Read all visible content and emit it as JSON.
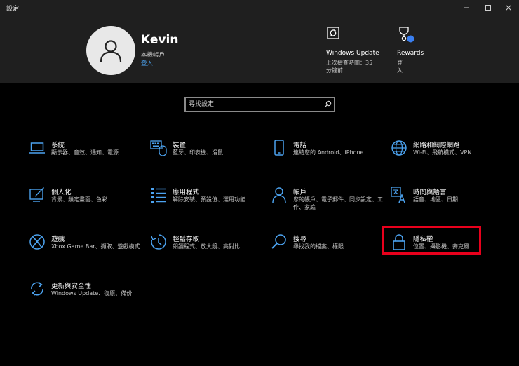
{
  "window": {
    "title": "設定"
  },
  "user": {
    "name": "Kevin",
    "account_type": "本機帳戶",
    "login_link": "登入"
  },
  "header_items": [
    {
      "label": "Windows Update",
      "sub": "上次檢查時間：35 分鐘前"
    },
    {
      "label": "Rewards",
      "sub": "登入"
    }
  ],
  "search": {
    "placeholder": "尋找設定"
  },
  "categories": [
    {
      "name": "系統",
      "desc": "顯示器、音效、通知、電源"
    },
    {
      "name": "裝置",
      "desc": "藍牙、印表機、滑鼠"
    },
    {
      "name": "電話",
      "desc": "連結您的 Android、iPhone"
    },
    {
      "name": "網路和網際網路",
      "desc": "Wi-Fi、飛航模式、VPN"
    },
    {
      "name": "個人化",
      "desc": "背景、鎖定畫面、色彩"
    },
    {
      "name": "應用程式",
      "desc": "解除安裝、預設值、選用功能"
    },
    {
      "name": "帳戶",
      "desc": "您的帳戶、電子郵件、同步設定、工作、家庭"
    },
    {
      "name": "時間與語言",
      "desc": "語音、地區、日期"
    },
    {
      "name": "遊戲",
      "desc": "Xbox Game Bar、擷取、遊戲模式"
    },
    {
      "name": "輕鬆存取",
      "desc": "朗讀程式、放大鏡、高對比"
    },
    {
      "name": "搜尋",
      "desc": "尋找我的檔案、權限"
    },
    {
      "name": "隱私權",
      "desc": "位置、攝影機、麥克風"
    },
    {
      "name": "更新與安全性",
      "desc": "Windows Update、復原、備份"
    }
  ],
  "colors": {
    "accent": "#4ca3f0",
    "highlight": "#e8001c",
    "header_bg": "#1f1f1f"
  }
}
